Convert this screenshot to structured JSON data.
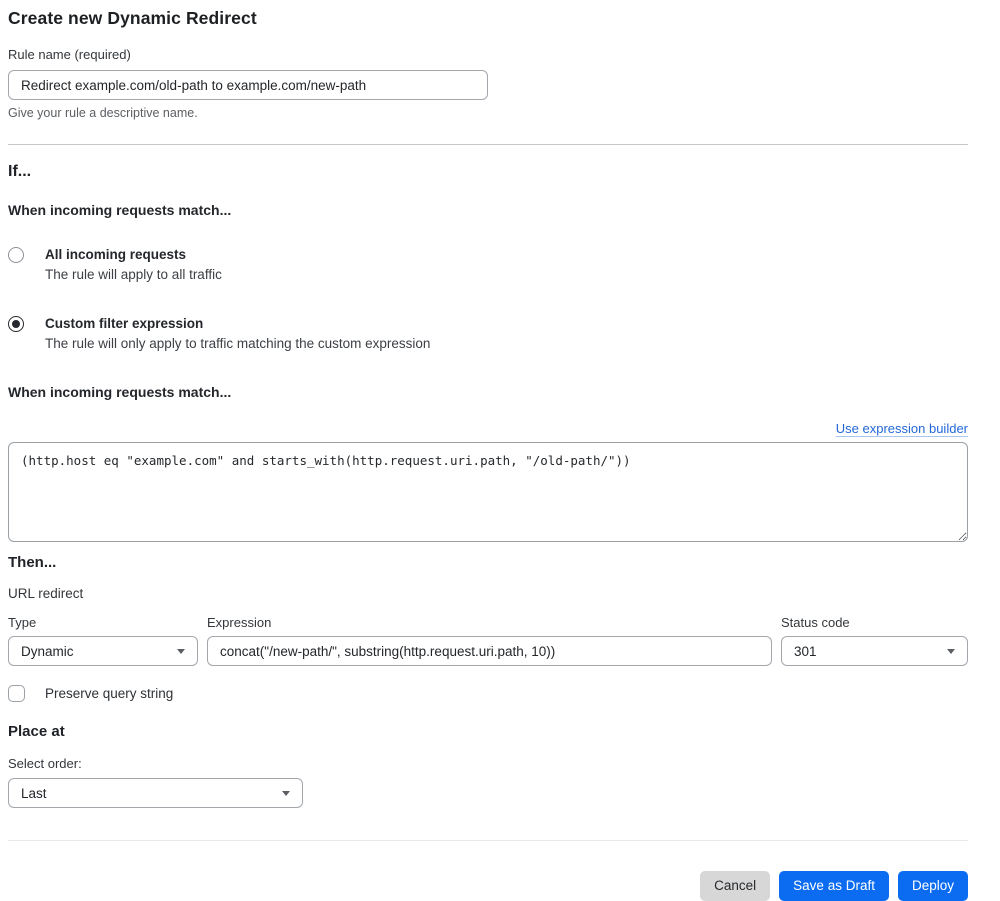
{
  "page": {
    "title": "Create new Dynamic Redirect"
  },
  "rule_name": {
    "label": "Rule name (required)",
    "value": "Redirect example.com/old-path to example.com/new-path",
    "help": "Give your rule a descriptive name."
  },
  "if_section": {
    "heading": "If...",
    "match_heading": "When incoming requests match...",
    "options": [
      {
        "label": "All incoming requests",
        "description": "The rule will apply to all traffic",
        "selected": false
      },
      {
        "label": "Custom filter expression",
        "description": "The rule will only apply to traffic matching the custom expression",
        "selected": true
      }
    ],
    "expression_heading": "When incoming requests match...",
    "builder_link_label": "Use expression builder",
    "expression_value": "(http.host eq \"example.com\" and starts_with(http.request.uri.path, \"/old-path/\"))"
  },
  "then_section": {
    "heading": "Then...",
    "subheading": "URL redirect",
    "type_field": {
      "label": "Type",
      "value": "Dynamic"
    },
    "expression_field": {
      "label": "Expression",
      "value": "concat(\"/new-path/\", substring(http.request.uri.path, 10))"
    },
    "status_field": {
      "label": "Status code",
      "value": "301"
    },
    "preserve_query": {
      "label": "Preserve query string",
      "checked": false
    }
  },
  "place_at": {
    "heading": "Place at",
    "label": "Select order:",
    "value": "Last"
  },
  "footer": {
    "cancel_label": "Cancel",
    "save_draft_label": "Save as Draft",
    "deploy_label": "Deploy"
  },
  "colors": {
    "primary_blue": "#0b6cf1",
    "link_blue": "#2368d8",
    "cancel_gray": "#d7d7d7"
  }
}
